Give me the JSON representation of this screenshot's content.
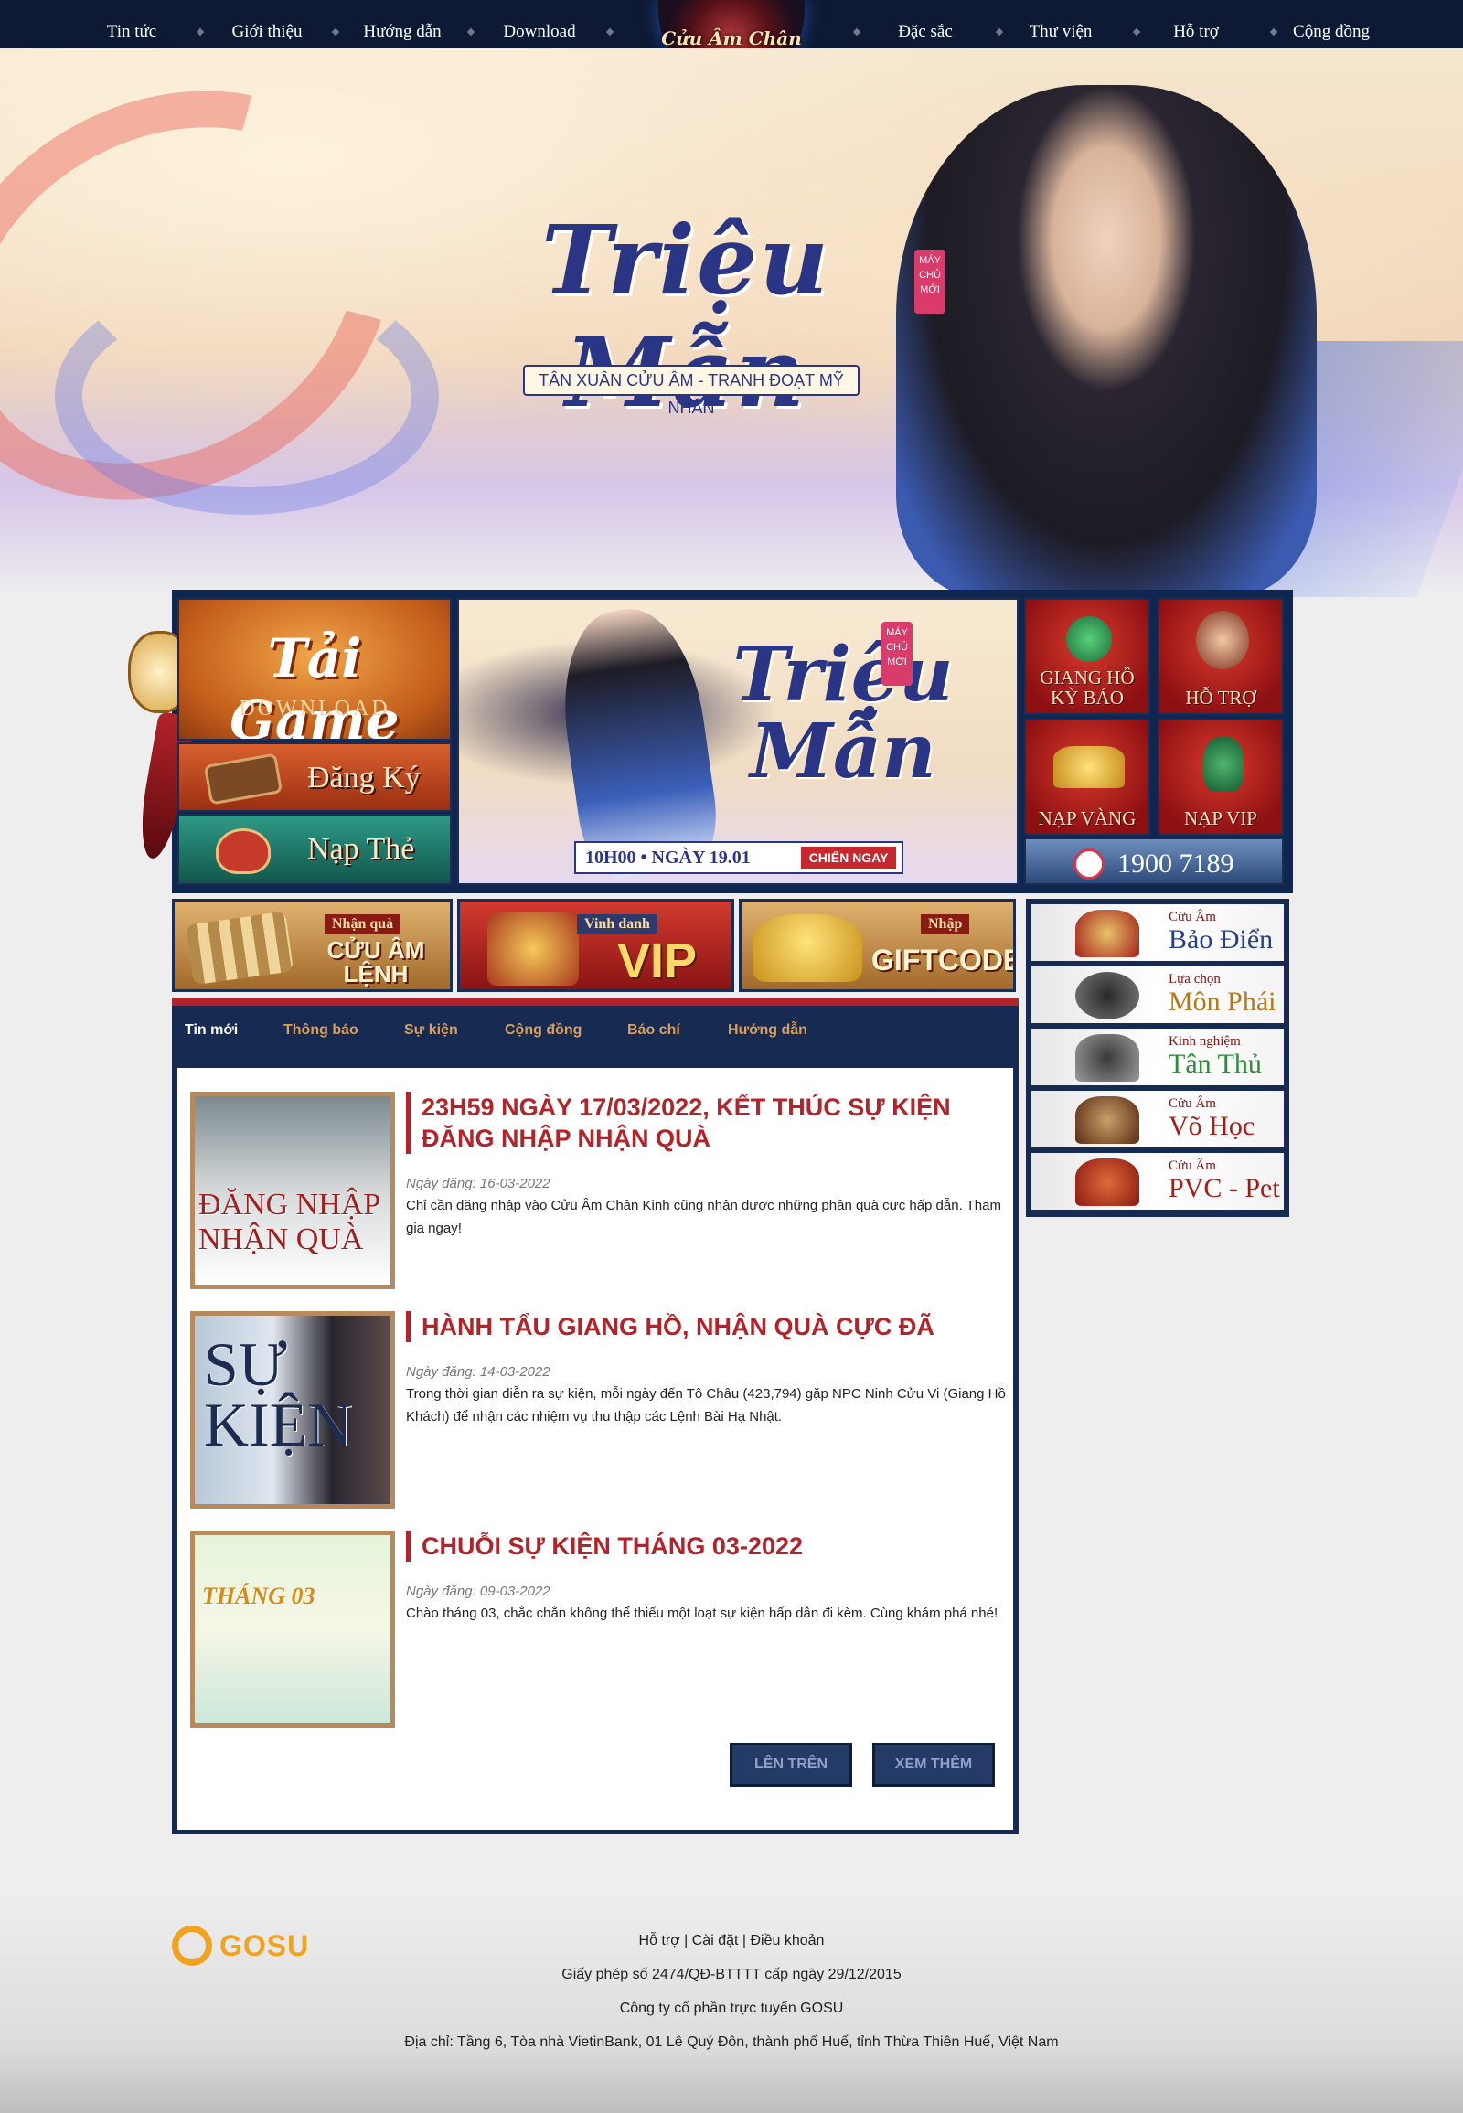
{
  "nav": {
    "left": [
      "Tin tức",
      "Giới thiệu",
      "Hướng dẫn",
      "Download"
    ],
    "right": [
      "Đặc sắc",
      "Thư viện",
      "Hỗ trợ",
      "Cộng đồng"
    ],
    "logo": "Cửu Âm Chân Kinh"
  },
  "hero": {
    "title": "Triệu Mẫn",
    "subtitle": "TÂN XUÂN CỬU ÂM - TRANH ĐOẠT MỸ NHÂN",
    "badge": "MÁY CHỦ MỚI"
  },
  "quick": {
    "taigame": "Tải Game",
    "download": "DOWNLOAD",
    "dangky": "Đăng Ký",
    "napthe": "Nạp Thẻ"
  },
  "banner": {
    "title": "Triệu Mẫn",
    "badge": "MÁY CHỦ MỚI",
    "time": "10H00 • NGÀY 19.01",
    "cta": "CHIẾN NGAY"
  },
  "tiles": [
    "GIANG HỒ KỲ BẢO",
    "HỖ TRỢ",
    "NẠP VÀNG",
    "NẠP VIP"
  ],
  "hotline": "1900 7189",
  "promos": [
    {
      "small": "Nhận quà",
      "big": "CỬU ÂM LỆNH"
    },
    {
      "small": "Vinh danh",
      "big": "VIP"
    },
    {
      "small": "Nhập",
      "big": "GIFTCODE"
    }
  ],
  "news": {
    "tabs": [
      "Tin mới",
      "Thông báo",
      "Sự kiện",
      "Cộng đồng",
      "Báo chí",
      "Hướng dẫn"
    ],
    "articles": [
      {
        "thumb_text": "ĐĂNG NHẬP NHẬN QUÀ",
        "title": "23H59 NGÀY 17/03/2022, KẾT THÚC SỰ KIỆN ĐĂNG NHẬP NHẬN QUÀ",
        "date": "Ngày đăng: 16-03-2022",
        "summary": "Chỉ cần đăng nhập vào Cửu Âm Chân Kinh cũng nhận được những phần quà cực hấp dẫn. Tham gia ngay!"
      },
      {
        "thumb_text": "SỰ KIỆN",
        "title": "HÀNH TẨU GIANG HỒ, NHẬN QUÀ CỰC ĐÃ",
        "date": "Ngày đăng: 14-03-2022",
        "summary": "Trong thời gian diễn ra sự kiện, mỗi ngày đến Tô Châu (423,794) gặp NPC Ninh Cửu Vi (Giang Hồ Khách) để nhận các nhiệm vụ thu thập các Lệnh Bài Hạ Nhật."
      },
      {
        "thumb_text": "THÁNG 03",
        "title": "CHUỖI SỰ KIỆN THÁNG 03-2022",
        "date": "Ngày đăng: 09-03-2022",
        "summary": "Chào tháng 03, chắc chắn không thể thiếu một loạt sự kiện hấp dẫn đi kèm. Cùng khám phá nhé!"
      }
    ],
    "btn_top": "LÊN TRÊN",
    "btn_more": "XEM THÊM"
  },
  "sidebar": [
    {
      "small": "Cửu Âm",
      "large": "Bảo Điển"
    },
    {
      "small": "Lựa chọn",
      "large": "Môn Phái"
    },
    {
      "small": "Kinh nghiệm",
      "large": "Tân Thủ"
    },
    {
      "small": "Cửu Âm",
      "large": "Võ Học"
    },
    {
      "small": "Cửu Âm",
      "large": "PVC - Pet"
    }
  ],
  "footer": {
    "brand": "GOSU",
    "links": [
      "Hỗ trợ",
      "Cài đặt",
      "Điều khoản"
    ],
    "license": "Giấy phép số 2474/QĐ-BTTTT cấp ngày 29/12/2015",
    "company": "Công ty cổ phần trực tuyến GOSU",
    "address": "Địa chỉ: Tầng 6, Tòa nhà VietinBank, 01 Lê Quý Đôn, thành phố Huế, tỉnh Thừa Thiên Huế, Việt Nam"
  },
  "colors": {
    "nav_bg": "#0e1a33",
    "panel_bg": "#172a52",
    "accent_red": "#b3232a",
    "tab_inactive": "#d99f5a",
    "gosu_orange": "#f2a21b"
  }
}
